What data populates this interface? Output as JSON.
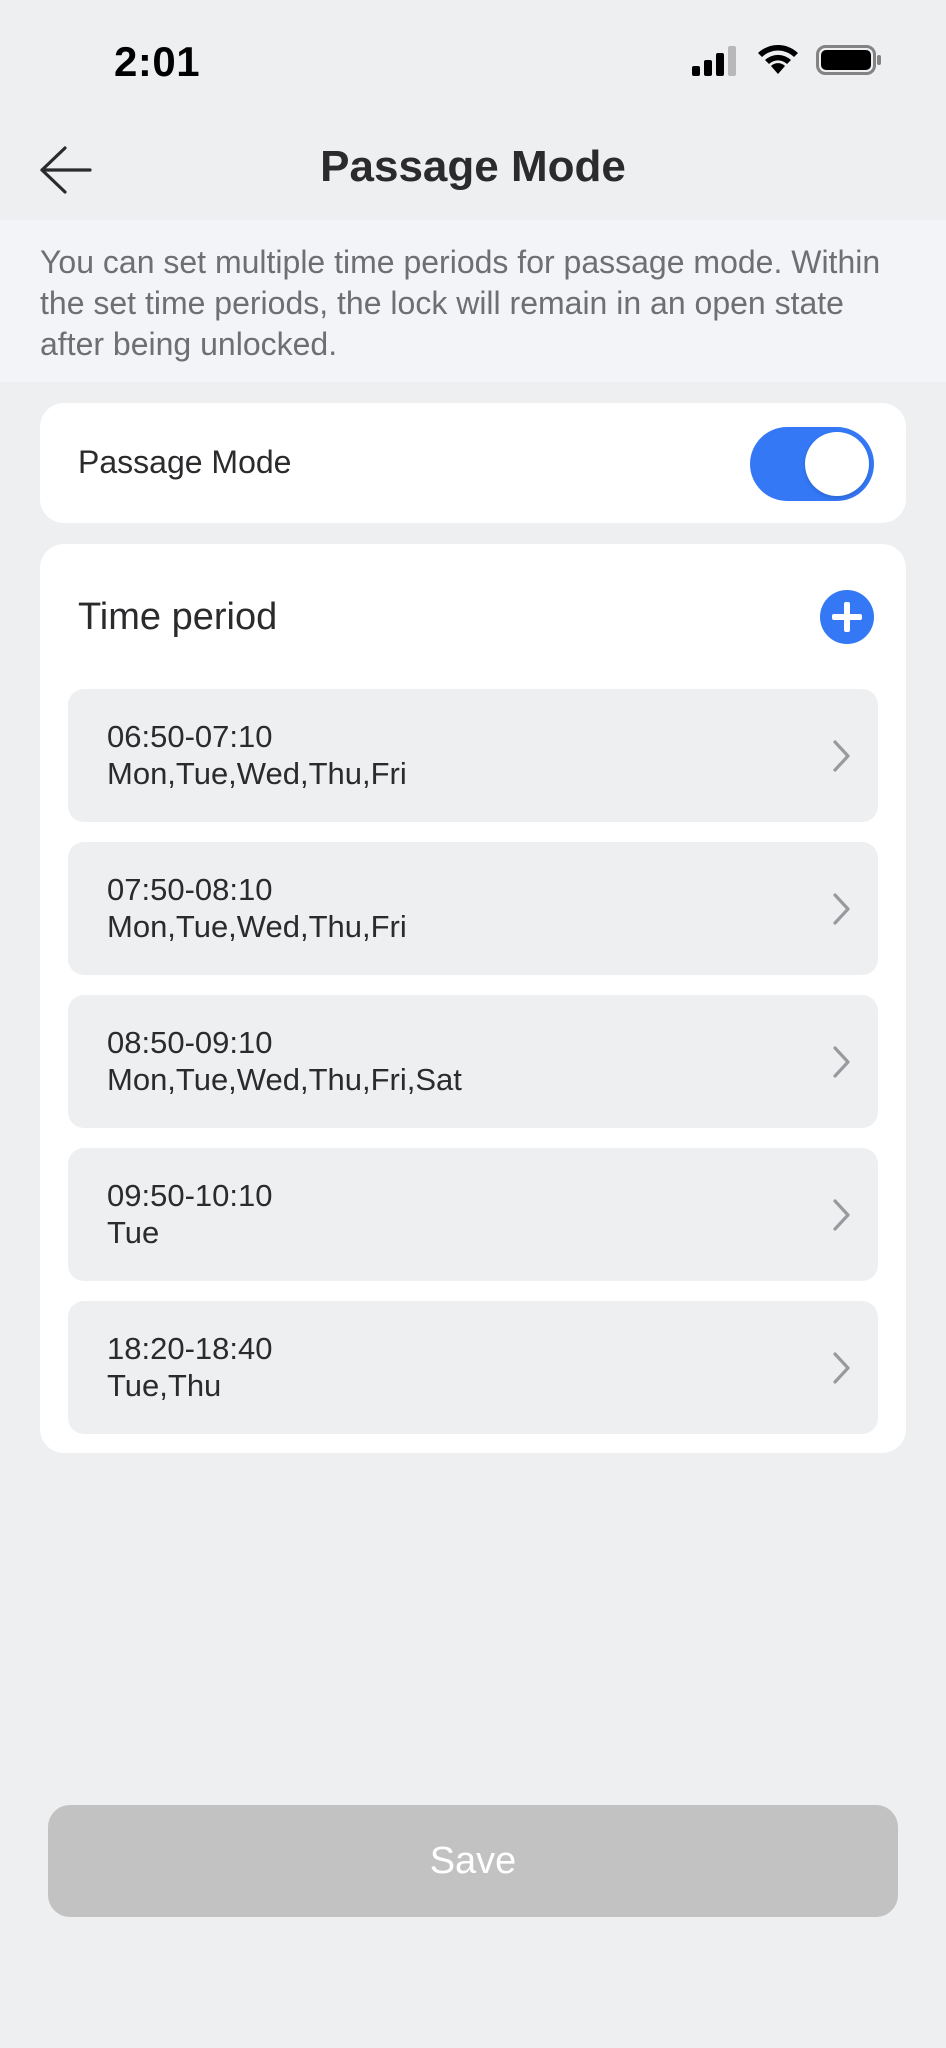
{
  "status_bar": {
    "time": "2:01",
    "icons": [
      "cellular-signal-icon",
      "wifi-icon",
      "battery-icon"
    ]
  },
  "nav": {
    "title": "Passage Mode",
    "back_icon": "arrow-left-icon"
  },
  "info": {
    "text": "You can set multiple time periods for passage mode. Within the set time periods, the lock will remain in an open state after being unlocked."
  },
  "toggle": {
    "label": "Passage Mode",
    "enabled": true
  },
  "time_periods": {
    "header": "Time period",
    "add_icon": "plus-circle-icon",
    "items": [
      {
        "time": "06:50-07:10",
        "days": "Mon,Tue,Wed,Thu,Fri"
      },
      {
        "time": "07:50-08:10",
        "days": "Mon,Tue,Wed,Thu,Fri"
      },
      {
        "time": "08:50-09:10",
        "days": "Mon,Tue,Wed,Thu,Fri,Sat"
      },
      {
        "time": "09:50-10:10",
        "days": "Tue"
      },
      {
        "time": "18:20-18:40",
        "days": "Tue,Thu"
      }
    ]
  },
  "save": {
    "label": "Save"
  },
  "colors": {
    "accent": "#3478f6",
    "background": "#eeeff1",
    "card": "#ffffff",
    "disabled_button": "#c2c2c2"
  }
}
